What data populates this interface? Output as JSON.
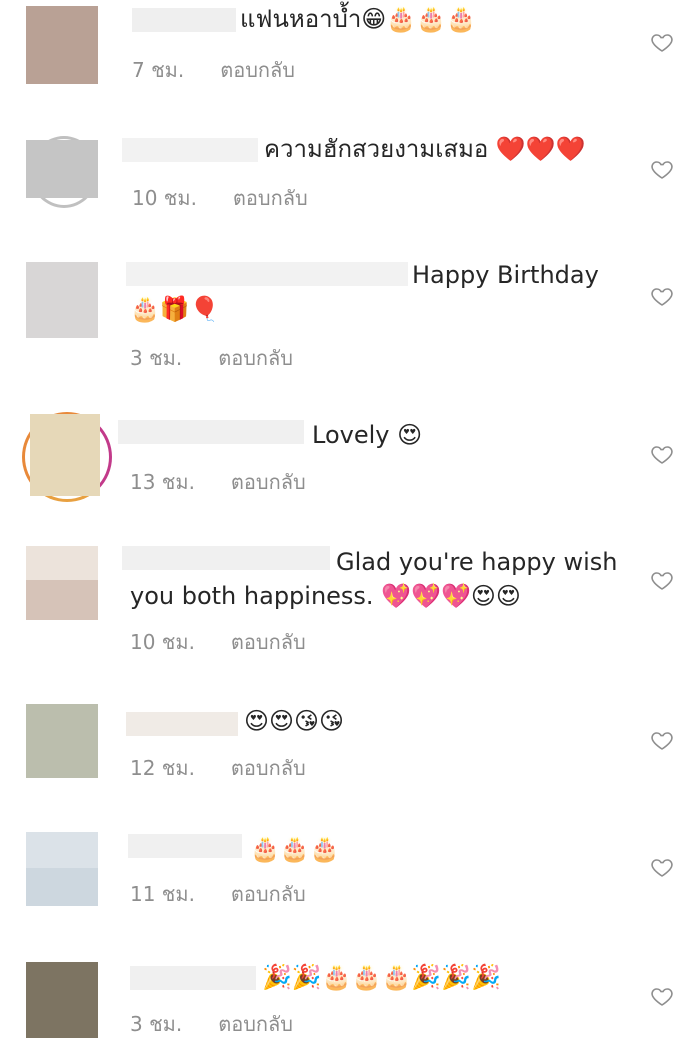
{
  "comments": [
    {
      "text": "แฟนหอาบ้ำ😁🎂🎂🎂",
      "time": "7 ชม.",
      "reply": "ตอบกลับ",
      "avatar_colors": [
        "#b9a195",
        "#b9a195"
      ]
    },
    {
      "text": "ความฮักสวยงามเสมอ ❤️❤️❤️",
      "time": "10 ชม.",
      "reply": "ตอบกลับ",
      "avatar_colors": [
        "#c5c5c5",
        "#c5c5c5"
      ]
    },
    {
      "text": "Happy Birthday",
      "text2": "🎂🎁🎈",
      "time": "3 ชม.",
      "reply": "ตอบกลับ",
      "avatar_colors": [
        "#d6d4d4",
        "#dcdcdc"
      ]
    },
    {
      "text": "Lovely 😍",
      "time": "13 ชม.",
      "reply": "ตอบกลับ",
      "avatar_colors": [
        "#e6d8b8",
        "#f0e8d6"
      ]
    },
    {
      "text": "Glad you're happy wish",
      "text2": "you both happiness. 💖💖💖😍😍",
      "time": "10 ชม.",
      "reply": "ตอบกลับ",
      "avatar_colors": [
        "#ece3db",
        "#d6c3b8"
      ]
    },
    {
      "text": "😍😍😘😘",
      "time": "12 ชม.",
      "reply": "ตอบกลับ",
      "avatar_colors": [
        "#b9bcaa",
        "#c3c6b6"
      ]
    },
    {
      "text": "🎂🎂🎂",
      "time": "11 ชม.",
      "reply": "ตอบกลับ",
      "avatar_colors": [
        "#d9e0e6",
        "#cfd8e0"
      ]
    },
    {
      "text": "🎉🎉🎂🎂🎂🎉🎉🎉",
      "time": "3 ชม.",
      "reply": "ตอบกลับ",
      "avatar_colors": [
        "#7d7462",
        "#7d7462"
      ]
    }
  ],
  "icons": {
    "like": "heart-outline-icon"
  },
  "colors": {
    "text": "#262626",
    "meta": "#8e8e8e",
    "heart_stroke": "#8e8e8e"
  }
}
